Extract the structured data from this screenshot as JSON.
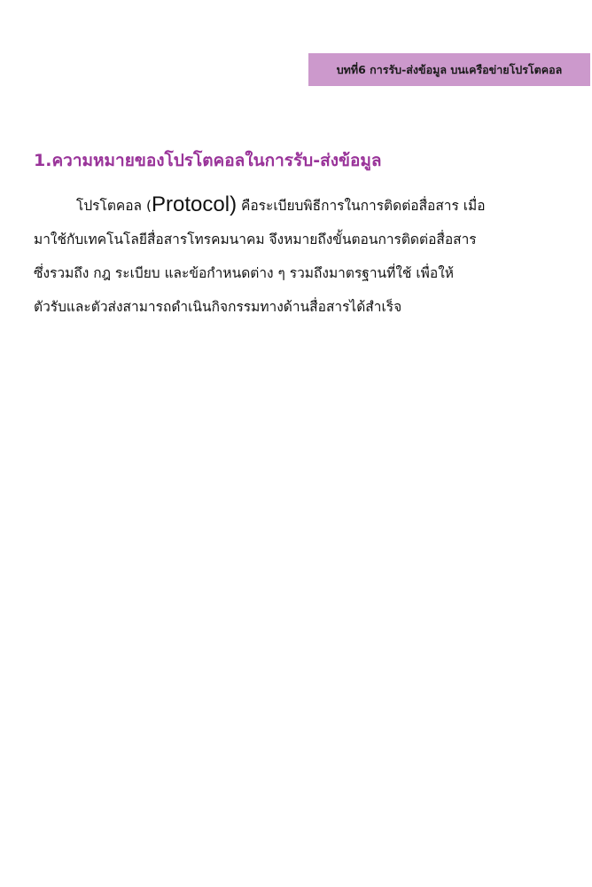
{
  "header": {
    "chapter_label": "บทที่6 การรับ-ส่งข้อมูล บนเครือข่ายโปรโตคอล"
  },
  "section": {
    "heading": "1.ความหมายของโปรโตคอลในการรับ-ส่งข้อมูล",
    "paragraph": {
      "line1_before": "โปรโตคอล (",
      "line1_term": "Protocol)",
      "line1_after": " คือระเบียบพิธีการในการติดต่อสื่อสาร เมื่อ",
      "line2": "มาใช้กับเทคโนโลยีสื่อสารโทรคมนาคม จึงหมายถึงขั้นตอนการติดต่อสื่อสาร",
      "line3": "ซึ่งรวมถึง กฎ ระเบียบ และข้อกำหนดต่าง ๆ รวมถึงมาตรฐานที่ใช้ เพื่อให้",
      "line4": "ตัวรับและตัวส่งสามารถดำเนินกิจกรรมทางด้านสื่อสารได้สำเร็จ"
    }
  },
  "colors": {
    "banner_background": "#cc99cc",
    "heading_text": "#993399",
    "body_text": "#111111"
  }
}
